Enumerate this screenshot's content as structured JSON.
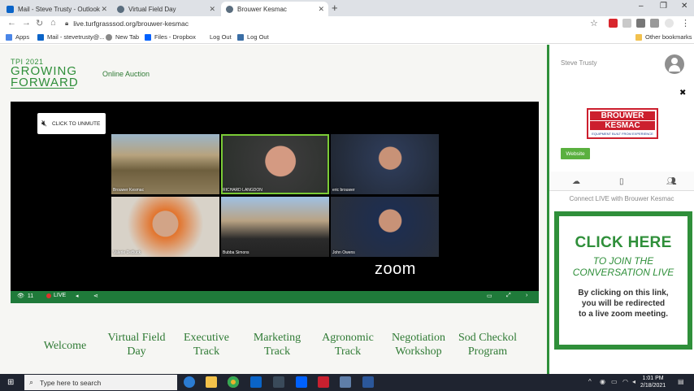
{
  "browser": {
    "tabs": [
      {
        "title": "Mail - Steve Trusty - Outlook",
        "icon_color": "#0a64c8"
      },
      {
        "title": "Virtual Field Day",
        "icon_color": "#5a6d7e"
      },
      {
        "title": "Brouwer Kesmac",
        "icon_color": "#5a6d7e"
      }
    ],
    "url": "live.turfgrasssod.org/brouwer-kesmac",
    "bookmarks": [
      "Apps",
      "Mail - stevetrusty@...",
      "New Tab",
      "Files - Dropbox",
      "Log Out",
      "Log Out"
    ],
    "other_bookmarks": "Other bookmarks"
  },
  "page": {
    "logo": {
      "line1": "TPI 2021",
      "line2": "GROWING",
      "line3": "FORWARD"
    },
    "subtitle": "Online Auction",
    "video": {
      "unmute_label": "CLICK TO UNMUTE",
      "participants": [
        {
          "name": "Brouwer Kesmac"
        },
        {
          "name": "RICHARD LANGDON"
        },
        {
          "name": "eric brouwer"
        },
        {
          "name": "Valerie DeBuck"
        },
        {
          "name": "Bubba Simons"
        },
        {
          "name": "John Owens"
        }
      ],
      "brand": "zoom",
      "viewers": "11",
      "live_label": "LIVE"
    },
    "menu": [
      {
        "line1": "Welcome",
        "line2": ""
      },
      {
        "line1": "Virtual Field",
        "line2": "Day"
      },
      {
        "line1": "Executive",
        "line2": "Track"
      },
      {
        "line1": "Marketing",
        "line2": "Track"
      },
      {
        "line1": "Agronomic",
        "line2": "Track"
      },
      {
        "line1": "Negotiation",
        "line2": "Workshop"
      },
      {
        "line1": "Sod Checkol",
        "line2": "Program"
      }
    ]
  },
  "sidebar": {
    "user_name": "Steve Trusty",
    "sponsor": {
      "line1": "BROUWER",
      "line2": "KESMAC",
      "tagline": "EQUIPMENT BUILT FROM EXPERIENCE"
    },
    "website_button": "Website",
    "connect_text": "Connect LIVE with Brouwer Kesmac",
    "cta": {
      "headline": "CLICK HERE",
      "sub1": "TO JOIN THE",
      "sub2": "CONVERSATION LIVE",
      "body1": "By clicking on this link,",
      "body2": "you will be redirected",
      "body3": "to a live zoom meeting."
    }
  },
  "taskbar": {
    "search_placeholder": "Type here to search",
    "time": "1:01 PM",
    "date": "2/18/2021"
  },
  "colors": {
    "brand_green": "#2f8f3a",
    "live_red": "#e0322b",
    "sponsor_red": "#cc1f2e"
  }
}
